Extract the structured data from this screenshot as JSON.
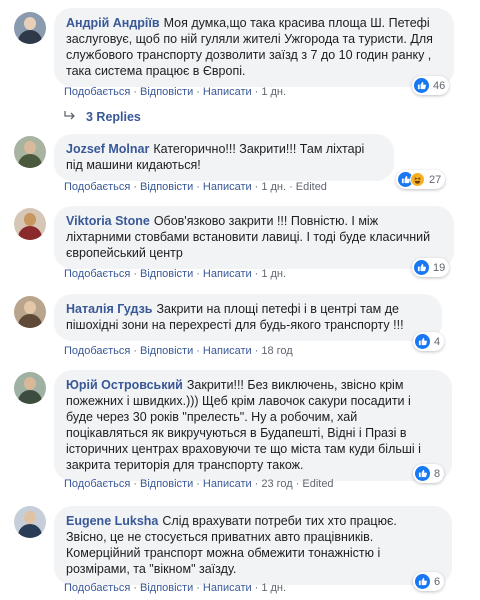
{
  "comments": [
    {
      "author": "Андрій Андріїв",
      "text": "Моя думка,що така красива площа Ш. Петефі заслуговує, щоб по ній гуляли жителі Ужгорода та туристи. Для службового транспорту дозволити заїзд з 7 до 10 годин ранку , така система працює в Європі.",
      "like_label": "Подобається",
      "reply_label": "Відповісти",
      "write_label": "Написати",
      "time": "1 дн.",
      "edited": "",
      "reaction_count": "46"
    },
    {
      "author": "Jozsef Molnar",
      "text": "Категорично!!! Закрити!!! Там ліхтарі під машини кидаються!",
      "like_label": "Подобається",
      "reply_label": "Відповісти",
      "write_label": "Написати",
      "time": "1 дн.",
      "edited": "Edited",
      "reaction_count": "27"
    },
    {
      "author": "Viktoria Stone",
      "text": "Обов'язково закрити !!! Повністю. І між ліхтарними стовбами встановити лавиці. І тоді буде класичний європейський центр",
      "like_label": "Подобається",
      "reply_label": "Відповісти",
      "write_label": "Написати",
      "time": "1 дн.",
      "edited": "",
      "reaction_count": "19"
    },
    {
      "author": "Наталія Гудзь",
      "text": "Закрити на площі петефі і в центрі там де пішохідні зони на перехресті для будь-якого транспорту !!!",
      "like_label": "Подобається",
      "reply_label": "Відповісти",
      "write_label": "Написати",
      "time": "18 год",
      "edited": "",
      "reaction_count": "4"
    },
    {
      "author": "Юрій Островський",
      "text": "Закрити!!! Без виключень, звісно крім пожежних і швидких.))) Щеб крім лавочок сакури посадити і буде через 30 років \"прелесть\". Ну а робочим, хай поцікавляться як викручуються в Будапешті, Відні і Празі в історичних центрах враховуючи те що міста там куди більші і закрита територія для транспорту також.",
      "like_label": "Подобається",
      "reply_label": "Відповісти",
      "write_label": "Написати",
      "time": "23 год",
      "edited": "Edited",
      "reaction_count": "8"
    },
    {
      "author": "Eugene Luksha",
      "text": "Слід врахувати потреби тих хто працює. Звісно, це не стосується приватних авто працівників. Комерційний транспорт можна обмежити тонажністю і розмірами, та \"вікном\" заїзду.",
      "like_label": "Подобається",
      "reply_label": "Відповісти",
      "write_label": "Написати",
      "time": "1 дн.",
      "edited": "",
      "reaction_count": "6"
    }
  ],
  "replies_link": "3 Replies",
  "colors": {
    "link": "#385898",
    "bubble": "#f2f3f5",
    "like_blue": "#1877f2",
    "meta_gray": "#606770"
  }
}
